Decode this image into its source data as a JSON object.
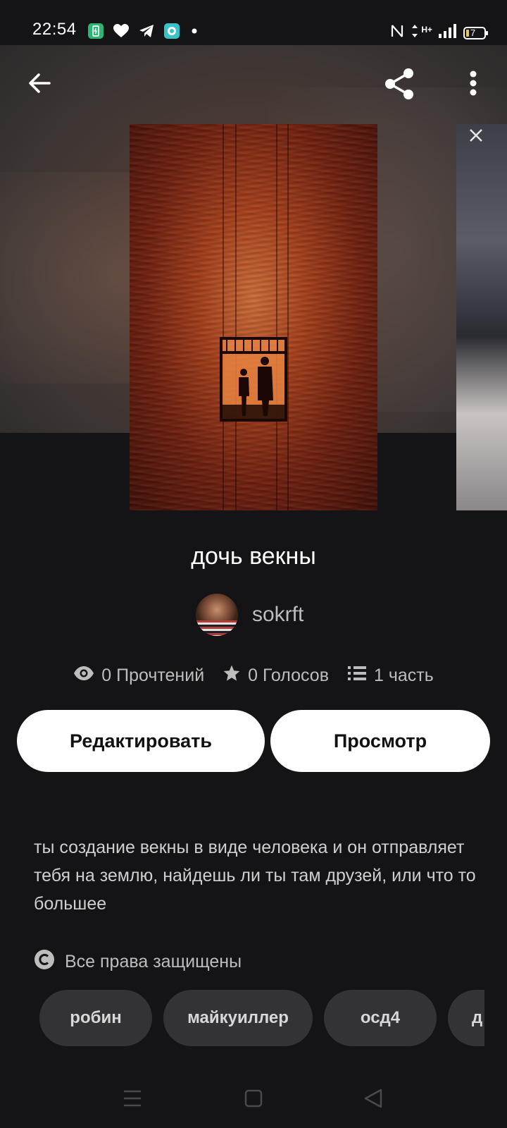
{
  "status_bar": {
    "time": "22:54",
    "battery_level": "7",
    "network_label": "H+",
    "icons": [
      "battery-saver-icon",
      "heart-icon",
      "telegram-icon",
      "chat-app-icon",
      "dot-icon",
      "nfc-icon",
      "data-arrows-icon",
      "signal-icon",
      "battery-icon"
    ]
  },
  "top_bar": {
    "icons": [
      "back-arrow-icon",
      "share-icon",
      "more-vert-icon"
    ]
  },
  "story": {
    "title": "дочь векны",
    "author": "sokrft",
    "stats": {
      "reads": "0 Прочтений",
      "votes": "0 Голосов",
      "parts": "1 часть"
    },
    "description": "ты создание векны в виде человека и он отправляет тебя на землю, найдешь ли ты там друзей, или что то большее",
    "rights": "Все права защищены"
  },
  "buttons": {
    "edit": "Редактировать",
    "view": "Просмотр"
  },
  "tags": [
    "робин",
    "майкуиллер",
    "осд4",
    "д"
  ],
  "colors": {
    "background": "#141316",
    "tag_background": "#333236",
    "button_background": "#ffffff",
    "secondary_text": "#bdbdbd"
  },
  "nav_bar": {
    "icons": [
      "recents-icon",
      "home-icon",
      "back-triangle-icon"
    ]
  }
}
